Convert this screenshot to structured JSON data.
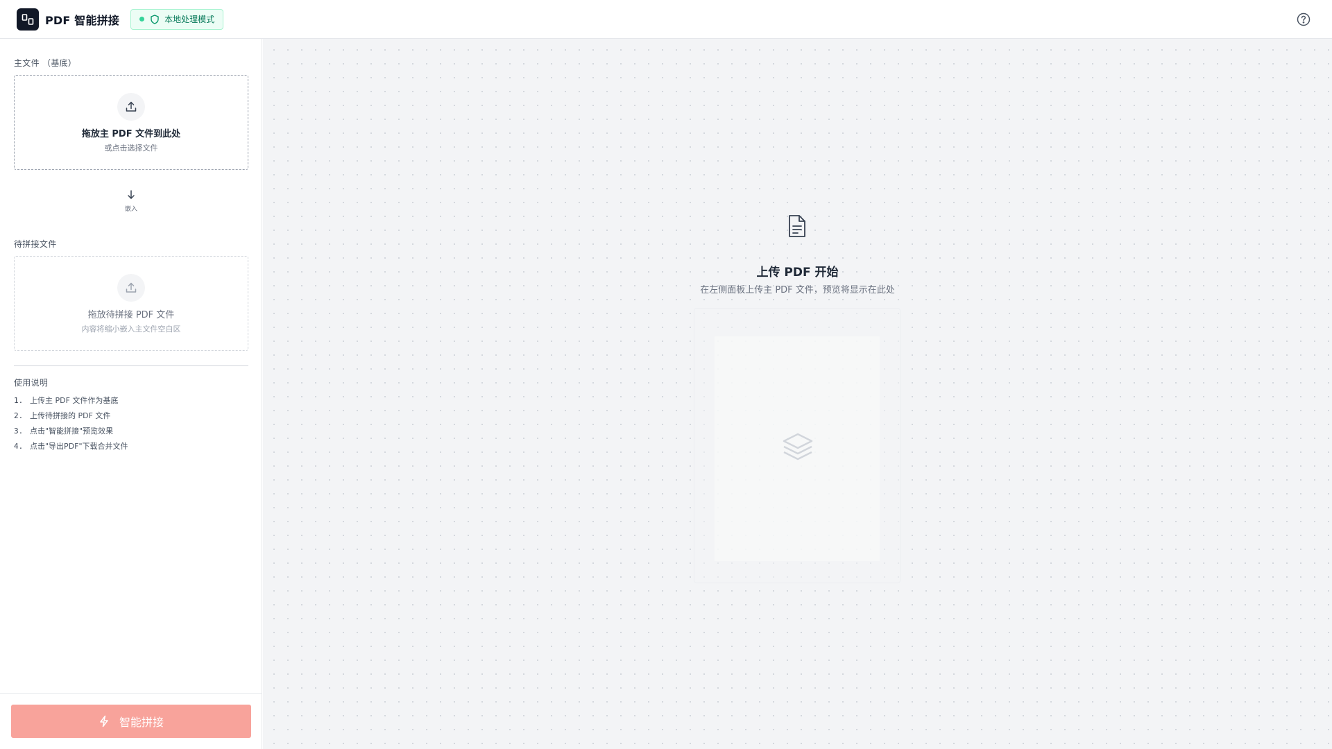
{
  "header": {
    "app_title": "PDF 智能拼接",
    "mode_badge": "本地处理模式",
    "logo_icon": "split-pages-icon",
    "help_icon": "question-circle-icon"
  },
  "sidebar": {
    "main_section_label": "主文件 （基底）",
    "main_dropzone": {
      "title": "拖放主 PDF 文件到此处",
      "subtitle": "或点击选择文件",
      "icon": "upload-icon"
    },
    "embed_label": "嵌入",
    "secondary_section_label": "待拼接文件",
    "secondary_dropzone": {
      "title": "拖放待拼接 PDF 文件",
      "subtitle": "内容将缩小嵌入主文件空白区",
      "icon": "upload-icon"
    },
    "instructions_title": "使用说明",
    "instructions": [
      {
        "num": "1.",
        "text": "上传主 PDF 文件作为基底"
      },
      {
        "num": "2.",
        "text": "上传待拼接的 PDF 文件"
      },
      {
        "num": "3.",
        "text": "点击\"智能拼接\"预览效果"
      },
      {
        "num": "4.",
        "text": "点击\"导出PDF\"下载合并文件"
      }
    ],
    "merge_button": "智能拼接"
  },
  "canvas": {
    "empty_title": "上传 PDF 开始",
    "empty_subtitle": "在左侧面板上传主 PDF 文件，预览将显示在此处"
  },
  "colors": {
    "accent_button": "#f8a39b",
    "badge_bg": "#ecfdf5",
    "badge_text": "#047857",
    "logo_bg": "#111827"
  }
}
